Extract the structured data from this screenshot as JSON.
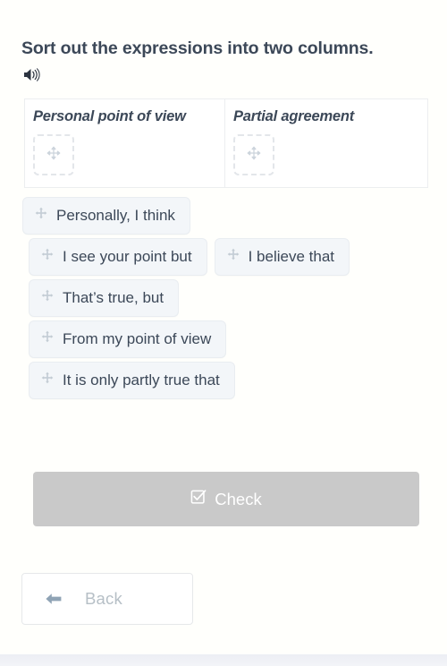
{
  "task": {
    "title": "Sort out the expressions into two columns.",
    "audio_icon": "speaker-icon"
  },
  "sorting_table": {
    "columns": [
      {
        "header": "Personal point of view",
        "drop_zone_icon": "move-icon",
        "items": []
      },
      {
        "header": "Partial agreement",
        "drop_zone_icon": "move-icon",
        "items": []
      }
    ]
  },
  "chips": [
    {
      "label": "Personally, I think",
      "icon": "move-icon"
    },
    {
      "label": "I see your point but",
      "icon": "move-icon"
    },
    {
      "label": "I believe that",
      "icon": "move-icon"
    },
    {
      "label": "That’s true, but",
      "icon": "move-icon"
    },
    {
      "label": "From my point of view",
      "icon": "move-icon"
    },
    {
      "label": "It is only partly true that",
      "icon": "move-icon"
    }
  ],
  "actions": {
    "check_label": "Check",
    "check_icon": "checkbox-checked-icon",
    "check_disabled": true,
    "back_label": "Back",
    "back_icon": "arrow-left-icon"
  },
  "colors": {
    "title_text": "#3c4858",
    "chip_bg": "#f3f6f9",
    "chip_border": "#e9edf1",
    "table_border": "#eceef0",
    "check_bg": "#c9c9c9",
    "back_text": "#b6bfc6",
    "back_arrow": "#8fa3b5",
    "move_icon": "#c3ccd4",
    "footer_band": "#eceef4"
  }
}
